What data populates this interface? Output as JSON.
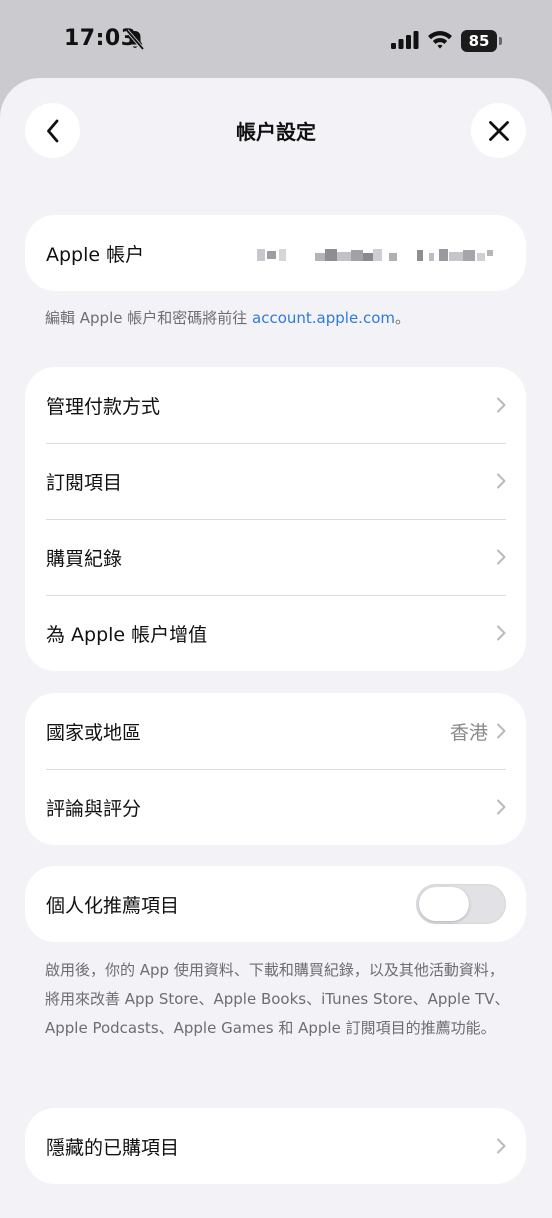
{
  "status_bar": {
    "time": "17:03",
    "battery": "85",
    "icons": [
      "bell-slash-icon",
      "cellular-signal-icon",
      "wifi-icon",
      "battery-icon"
    ]
  },
  "nav": {
    "title": "帳户設定",
    "back_icon": "chevron-left-icon",
    "close_icon": "close-icon"
  },
  "account": {
    "label": "Apple 帳户",
    "footnote_prefix": "編輯 Apple 帳户和密碼將前往 ",
    "footnote_link": "account.apple.com",
    "footnote_suffix": "。"
  },
  "billing_group": {
    "items": [
      {
        "label": "管理付款方式"
      },
      {
        "label": "訂閱項目"
      },
      {
        "label": "購買紀錄"
      },
      {
        "label": "為 Apple 帳户增值"
      }
    ]
  },
  "region_group": {
    "items": [
      {
        "label": "國家或地區",
        "value": "香港"
      },
      {
        "label": "評論與評分"
      }
    ]
  },
  "personalization": {
    "label": "個人化推薦項目",
    "toggle_on": false,
    "footnote": "啟用後，你的 App 使用資料、下載和購買紀錄，以及其他活動資料，將用來改善 App Store、Apple Books、iTunes Store、Apple TV、Apple Podcasts、Apple Games 和 Apple 訂閱項目的推薦功能。"
  },
  "hidden_purchases": {
    "label": "隱藏的已購項目"
  },
  "colors": {
    "accent_link": "#2f7bd8",
    "background": "#f2f2f7",
    "card": "#ffffff",
    "secondary_text": "#6d6d72"
  }
}
